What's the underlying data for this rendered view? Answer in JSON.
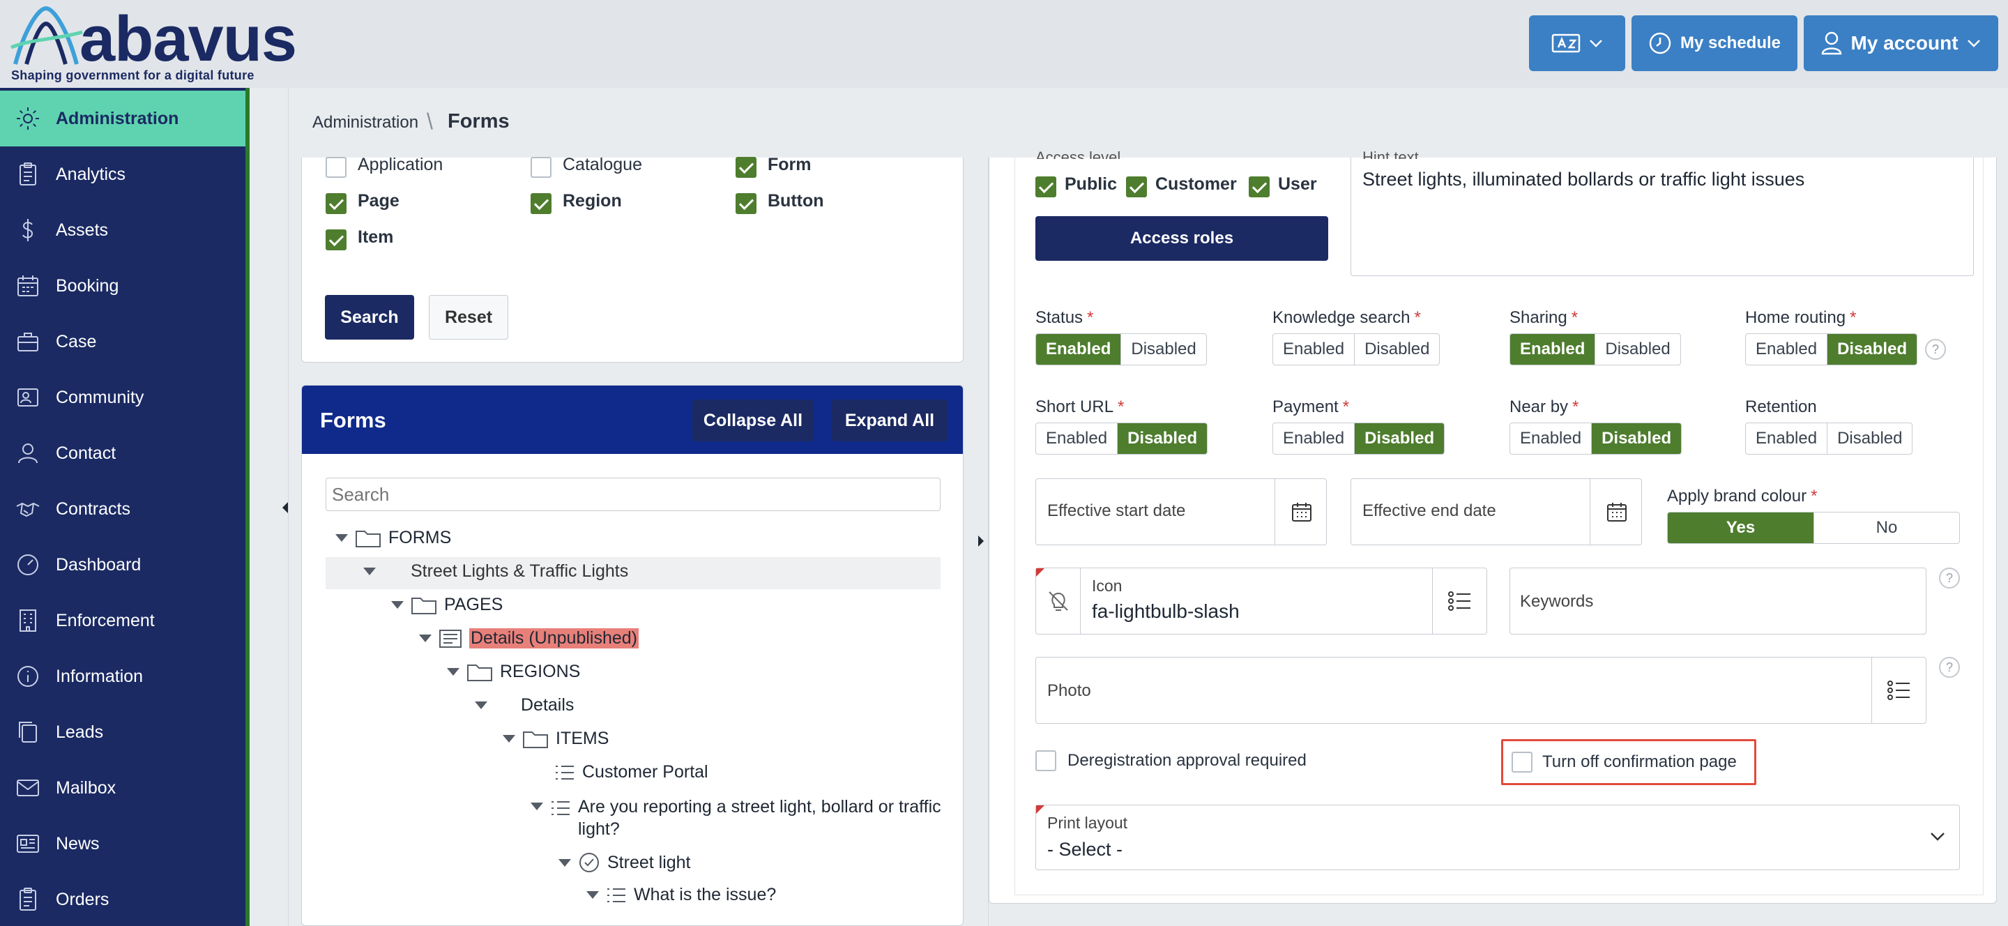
{
  "brand": {
    "name": "abavus",
    "tagline": "Shaping government for a digital future"
  },
  "header": {
    "schedule_label": "My schedule",
    "account_label": "My account"
  },
  "sidebar": {
    "items": [
      {
        "label": "Administration",
        "icon": "gear-icon"
      },
      {
        "label": "Analytics",
        "icon": "clipboard-icon"
      },
      {
        "label": "Assets",
        "icon": "dollar-icon"
      },
      {
        "label": "Booking",
        "icon": "calendar-icon"
      },
      {
        "label": "Case",
        "icon": "briefcase-icon"
      },
      {
        "label": "Community",
        "icon": "people-icon"
      },
      {
        "label": "Contact",
        "icon": "user-icon"
      },
      {
        "label": "Contracts",
        "icon": "handshake-icon"
      },
      {
        "label": "Dashboard",
        "icon": "gauge-icon"
      },
      {
        "label": "Enforcement",
        "icon": "building-icon"
      },
      {
        "label": "Information",
        "icon": "info-icon"
      },
      {
        "label": "Leads",
        "icon": "copy-icon"
      },
      {
        "label": "Mailbox",
        "icon": "mail-icon"
      },
      {
        "label": "News",
        "icon": "newspaper-icon"
      },
      {
        "label": "Orders",
        "icon": "clipboard-icon"
      }
    ]
  },
  "breadcrumb": {
    "parent": "Administration",
    "separator": "\\",
    "current": "Forms"
  },
  "filters": {
    "options": [
      {
        "label": "Application",
        "checked": false
      },
      {
        "label": "Catalogue",
        "checked": false
      },
      {
        "label": "Form",
        "checked": true
      },
      {
        "label": "Page",
        "checked": true
      },
      {
        "label": "Region",
        "checked": true
      },
      {
        "label": "Button",
        "checked": true
      },
      {
        "label": "Item",
        "checked": true
      }
    ],
    "search_label": "Search",
    "reset_label": "Reset"
  },
  "forms_panel": {
    "title": "Forms",
    "collapse_label": "Collapse All",
    "expand_label": "Expand All",
    "search_placeholder": "Search",
    "tree": {
      "root": "FORMS",
      "form": "Street Lights & Traffic Lights",
      "pages": "PAGES",
      "details_page": "Details (Unpublished)",
      "regions": "REGIONS",
      "details_region": "Details",
      "items": "ITEMS",
      "item_portal": "Customer Portal",
      "item_question": "Are you reporting a street light, bollard or traffic",
      "item_question_cont": "light?",
      "street_light": "Street light",
      "what_issue": "What is the issue?"
    }
  },
  "detail": {
    "access_level_label": "Access level",
    "access_public": "Public",
    "access_customer": "Customer",
    "access_user": "User",
    "access_roles_label": "Access roles",
    "hint_label": "Hint text",
    "hint_value": "Street lights, illuminated bollards or traffic light issues",
    "enabled": "Enabled",
    "disabled": "Disabled",
    "status_label": "Status",
    "knowledge_label": "Knowledge search",
    "sharing_label": "Sharing",
    "home_routing_label": "Home routing",
    "short_url_label": "Short URL",
    "payment_label": "Payment",
    "near_by_label": "Near by",
    "retention_label": "Retention",
    "start_date_placeholder": "Effective start date",
    "end_date_placeholder": "Effective end date",
    "brand_colour_label": "Apply brand colour",
    "yes": "Yes",
    "no": "No",
    "icon_label": "Icon",
    "icon_value": "fa-lightbulb-slash",
    "keywords_placeholder": "Keywords",
    "photo_placeholder": "Photo",
    "dereg_label": "Deregistration approval required",
    "turn_off_label": "Turn off confirmation page",
    "print_layout_label": "Print layout",
    "print_layout_value": "- Select -",
    "required_mark": "*",
    "help_mark": "?"
  },
  "colors": {
    "navy": "#1b2a63",
    "green": "#4e7d2e",
    "mint": "#5fd3b0",
    "header_btn": "#3b7fc4",
    "highlight": "#e24a3a"
  }
}
